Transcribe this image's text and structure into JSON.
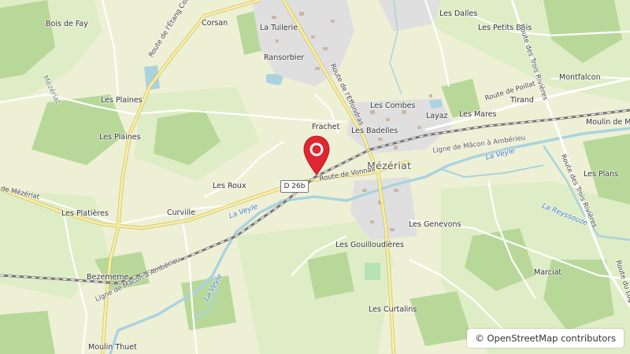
{
  "map": {
    "places": [
      "Bois de Fay",
      "Corsan",
      "La Tuilerie",
      "Les Dalles",
      "Les Petits Bois",
      "Ransorbier",
      "Montfalcon",
      "Les Plaines",
      "Les Plaines",
      "Les Combes",
      "Tirand",
      "Frachet",
      "Layaz",
      "Les Mares",
      "Les Badelles",
      "Moulin de M",
      "Les Plans",
      "Les Roux",
      "Curville",
      "Les Platières",
      "Les Genevons",
      "Les Gouilloudières",
      "Bezememe",
      "Marciat",
      "Les Curtalins",
      "Moulin Thuet"
    ],
    "town": "Mézériat",
    "roads": [
      "Route de l'Étang Coton",
      "Route de l'Effondras",
      "Route des Trois Rivières",
      "Route des Trois Rivières",
      "Route de Poillat",
      "Route de Vonnas",
      "Route du Logis",
      "de Mézériat"
    ],
    "road_ref": "D 26b",
    "waterways": [
      "La Veyle",
      "La Veyle",
      "La Veyle",
      "La Reyssouze",
      "Mézériat"
    ],
    "railways": [
      "Ligne de Mâcon à Ambérieu",
      "Ligne de Mâcon à Ambérieu"
    ],
    "marker_color": "#e0262f"
  },
  "attribution": {
    "symbol": "©",
    "text": "OpenStreetMap contributors"
  }
}
